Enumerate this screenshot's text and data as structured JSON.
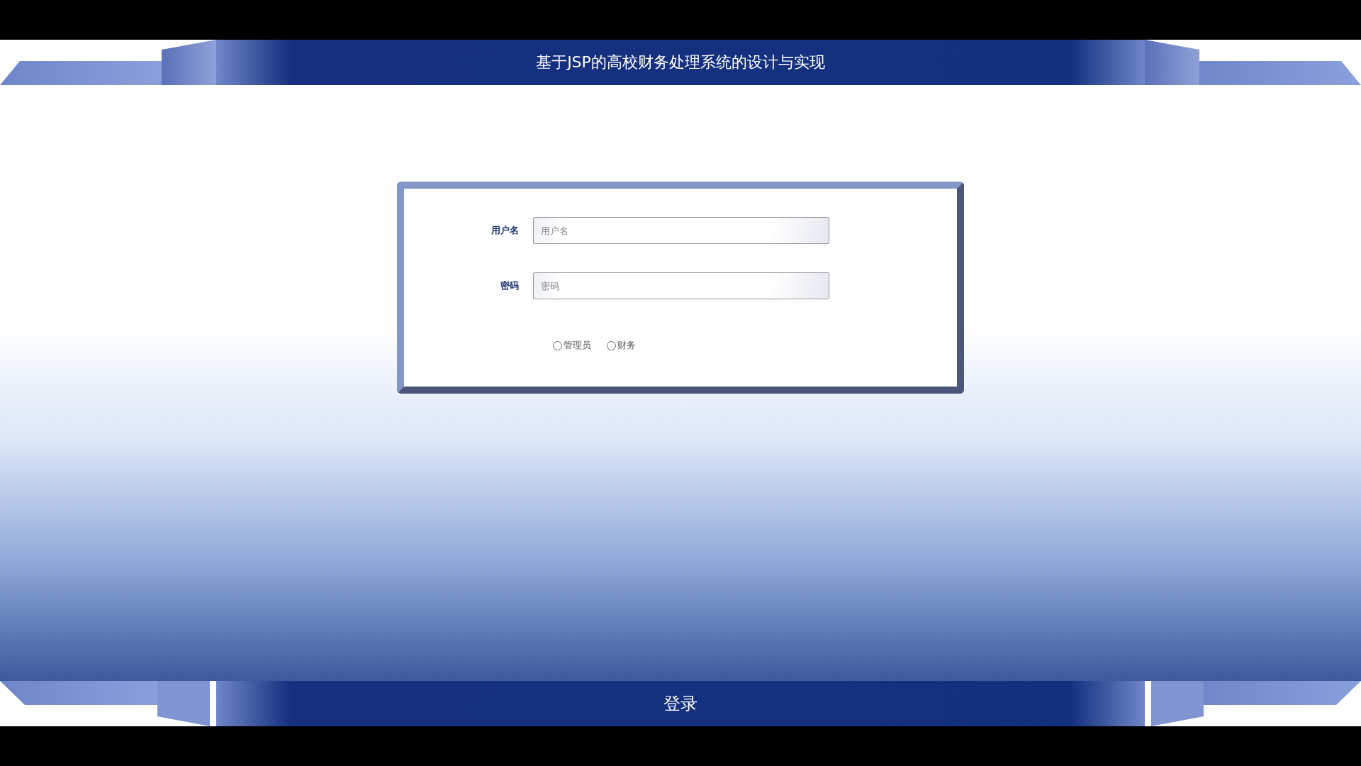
{
  "header": {
    "title": "基于JSP的高校财务处理系统的设计与实现"
  },
  "form": {
    "fields": [
      {
        "label": "用户名",
        "placeholder": "用户名"
      },
      {
        "label": "密码",
        "placeholder": "密码"
      }
    ],
    "roles": [
      {
        "label": "管理员",
        "selected": false
      },
      {
        "label": "财务",
        "selected": false
      }
    ]
  },
  "footer": {
    "button": "登录"
  }
}
